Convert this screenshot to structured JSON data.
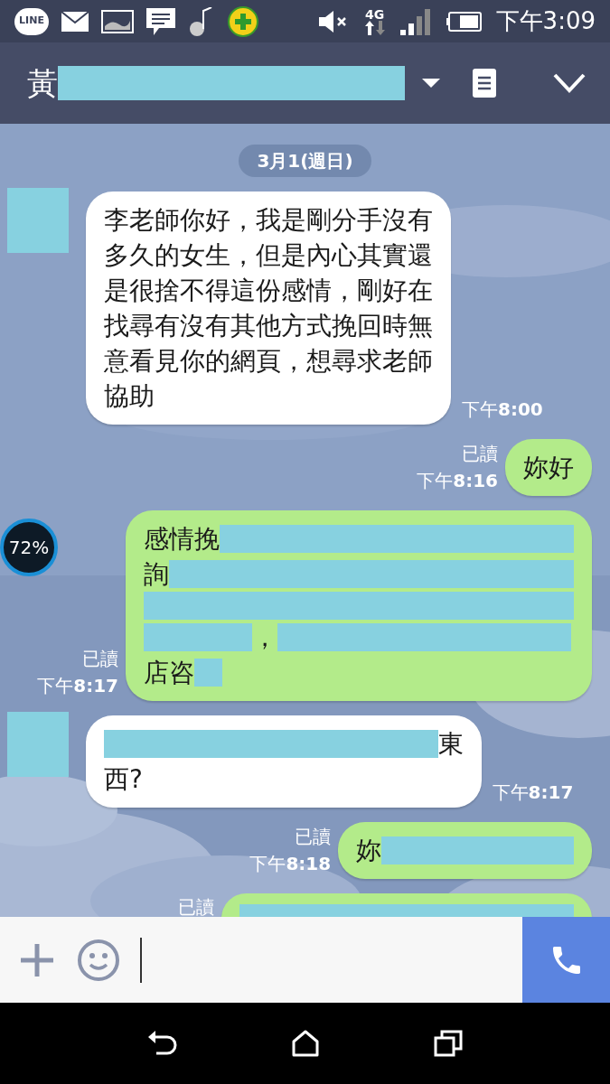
{
  "status_bar": {
    "notifications": [
      {
        "kind": "line",
        "label": "LINE"
      },
      {
        "kind": "mail"
      },
      {
        "kind": "gallery"
      },
      {
        "kind": "message"
      },
      {
        "kind": "music"
      },
      {
        "kind": "plus"
      }
    ],
    "network": "4G",
    "time": "下午3:09"
  },
  "header": {
    "title": [
      {
        "kind": "text",
        "text": "黃"
      },
      {
        "kind": "masktitle"
      }
    ]
  },
  "date": "3月1(週日)",
  "floating_widget": {
    "text": "72%"
  },
  "messages": [
    {
      "outgoing": false,
      "has_avatar": true,
      "time": "下午**8:00**",
      "lines": [
        [
          {
            "kind": "text",
            "text": "李老師你好，我是剛分手沒有"
          }
        ],
        [
          {
            "kind": "text",
            "text": "多久的女生，但是內心其實還"
          }
        ],
        [
          {
            "kind": "text",
            "text": "是很捨不得這份感情，剛好在"
          }
        ],
        [
          {
            "kind": "text",
            "text": "找尋有沒有其他方式挽回時無"
          }
        ],
        [
          {
            "kind": "text",
            "text": "意看見你的網頁，想尋求老師"
          }
        ],
        [
          {
            "kind": "text",
            "text": "協助"
          }
        ]
      ]
    },
    {
      "outgoing": true,
      "read": "已讀",
      "time": "下午**8:16**",
      "lines": [
        [
          {
            "kind": "text",
            "text": "妳好"
          }
        ]
      ]
    },
    {
      "outgoing": true,
      "read": "已讀",
      "time": "下午**8:17**",
      "lines": [
        [
          {
            "kind": "text",
            "text": "感情挽"
          },
          {
            "kind": "masklonger"
          }
        ],
        [
          {
            "kind": "text",
            "text": "詢"
          },
          {
            "kind": "maskfull"
          }
        ],
        [
          {
            "kind": "maskwidest"
          }
        ],
        [
          {
            "kind": "maskshort"
          },
          {
            "kind": "text",
            "text": "，"
          },
          {
            "kind": "masklong"
          }
        ],
        [
          {
            "kind": "text",
            "text": "店咨"
          },
          {
            "kind": "masktiny"
          }
        ]
      ]
    },
    {
      "outgoing": false,
      "has_avatar": true,
      "time": "下午**8:17**",
      "lines": [
        [
          {
            "kind": "masklongest"
          },
          {
            "kind": "text",
            "text": "東"
          }
        ],
        [
          {
            "kind": "text",
            "text": "西?"
          }
        ]
      ]
    },
    {
      "outgoing": true,
      "read": "已讀",
      "time": "下午**8:18**",
      "lines": [
        [
          {
            "kind": "text",
            "text": "妳"
          },
          {
            "kind": "maskmedium"
          }
        ]
      ]
    },
    {
      "outgoing": true,
      "read": "已讀",
      "lines": [
        [
          {
            "kind": "masklongest"
          }
        ]
      ]
    }
  ]
}
